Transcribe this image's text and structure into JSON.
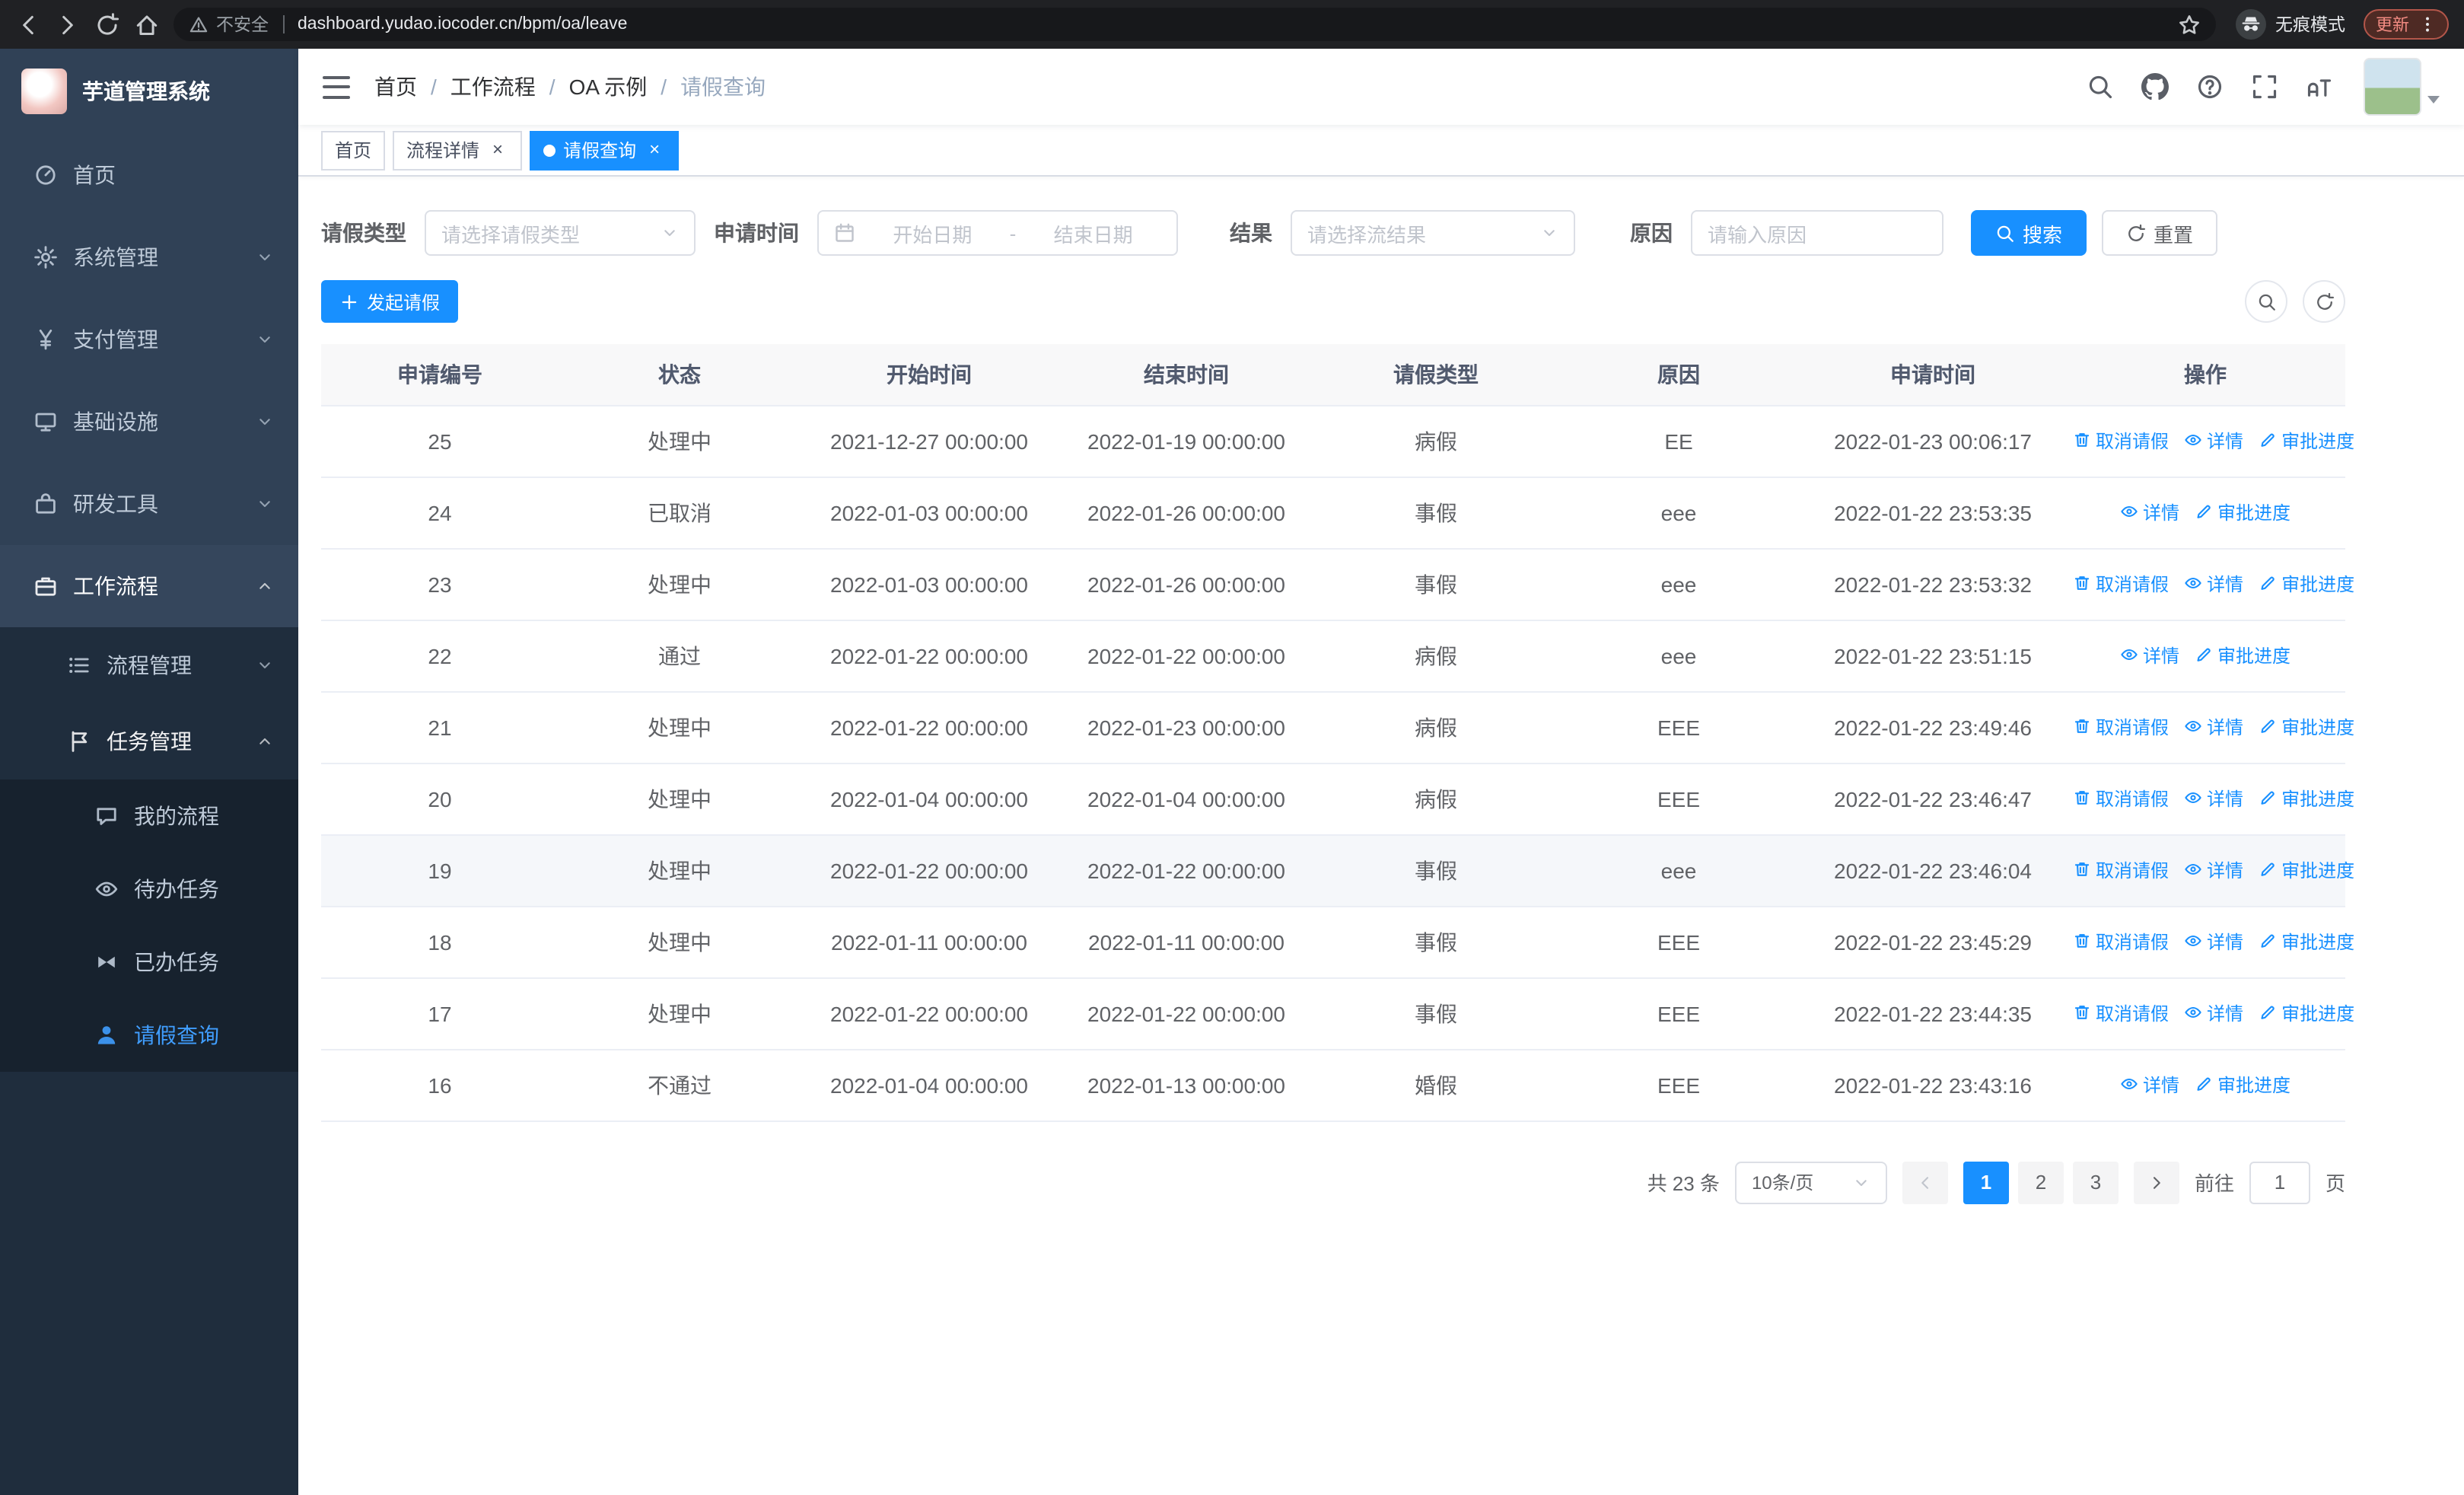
{
  "colors": {
    "primary": "#1890ff",
    "sidebar_bg": "#1f2d3d",
    "sidebar_top": "#304156",
    "sidebar_sub": "#1f2d3d",
    "sidebar_active_text": "#409eff",
    "table_header_bg": "#f8f8f9"
  },
  "browser": {
    "url": "dashboard.yudao.iocoder.cn/bpm/oa/leave",
    "security_warning": "不安全",
    "incognito_label": "无痕模式",
    "update_button": "更新"
  },
  "sidebar": {
    "logo_title": "芋道管理系统",
    "items": [
      {
        "key": "home",
        "label": "首页",
        "icon": "dashboard-icon",
        "level": 1
      },
      {
        "key": "system",
        "label": "系统管理",
        "icon": "gear-icon",
        "level": 1,
        "chevron": "down"
      },
      {
        "key": "payment",
        "label": "支付管理",
        "icon": "yen-icon",
        "level": 1,
        "chevron": "down"
      },
      {
        "key": "infra",
        "label": "基础设施",
        "icon": "infra-icon",
        "level": 1,
        "chevron": "down"
      },
      {
        "key": "devtools",
        "label": "研发工具",
        "icon": "tool-icon",
        "level": 1,
        "chevron": "down"
      },
      {
        "key": "workflow",
        "label": "工作流程",
        "icon": "briefcase-icon",
        "level": 1,
        "chevron": "up",
        "active_parent": true
      },
      {
        "key": "process-mgmt",
        "label": "流程管理",
        "icon": "list-icon",
        "level": 2,
        "chevron": "down"
      },
      {
        "key": "task-mgmt",
        "label": "任务管理",
        "icon": "flag-icon",
        "level": 2,
        "chevron": "up",
        "ancestor": true
      },
      {
        "key": "my-process",
        "label": "我的流程",
        "icon": "chat-icon",
        "level": 3
      },
      {
        "key": "todo-tasks",
        "label": "待办任务",
        "icon": "eye-icon",
        "level": 3
      },
      {
        "key": "done-tasks",
        "label": "已办任务",
        "icon": "bowtie-icon",
        "level": 3
      },
      {
        "key": "leave-query",
        "label": "请假查询",
        "icon": "user-icon",
        "level": 3,
        "active": true
      }
    ]
  },
  "header": {
    "breadcrumb": [
      "首页",
      "工作流程",
      "OA 示例",
      "请假查询"
    ]
  },
  "tabs": [
    {
      "key": "home",
      "label": "首页",
      "closable": false,
      "active": false
    },
    {
      "key": "process-detail",
      "label": "流程详情",
      "closable": true,
      "active": false
    },
    {
      "key": "leave-query",
      "label": "请假查询",
      "closable": true,
      "active": true
    }
  ],
  "filters": {
    "leave_type_label": "请假类型",
    "leave_type_placeholder": "请选择请假类型",
    "apply_time_label": "申请时间",
    "start_date_placeholder": "开始日期",
    "range_separator": "-",
    "end_date_placeholder": "结束日期",
    "result_label": "结果",
    "result_placeholder": "请选择流结果",
    "reason_label": "原因",
    "reason_placeholder": "请输入原因",
    "search_button": "搜索",
    "reset_button": "重置"
  },
  "toolbar": {
    "create_button": "发起请假"
  },
  "table": {
    "columns": [
      "申请编号",
      "状态",
      "开始时间",
      "结束时间",
      "请假类型",
      "原因",
      "申请时间",
      "操作"
    ],
    "action_labels": {
      "cancel": "取消请假",
      "detail": "详情",
      "progress": "审批进度"
    },
    "rows": [
      {
        "id": "25",
        "status": "处理中",
        "start": "2021-12-27 00:00:00",
        "end": "2022-01-19 00:00:00",
        "type": "病假",
        "reason": "EE",
        "applied": "2022-01-23 00:06:17",
        "actions": [
          "cancel",
          "detail",
          "progress"
        ]
      },
      {
        "id": "24",
        "status": "已取消",
        "start": "2022-01-03 00:00:00",
        "end": "2022-01-26 00:00:00",
        "type": "事假",
        "reason": "eee",
        "applied": "2022-01-22 23:53:35",
        "actions": [
          "detail",
          "progress"
        ]
      },
      {
        "id": "23",
        "status": "处理中",
        "start": "2022-01-03 00:00:00",
        "end": "2022-01-26 00:00:00",
        "type": "事假",
        "reason": "eee",
        "applied": "2022-01-22 23:53:32",
        "actions": [
          "cancel",
          "detail",
          "progress"
        ]
      },
      {
        "id": "22",
        "status": "通过",
        "start": "2022-01-22 00:00:00",
        "end": "2022-01-22 00:00:00",
        "type": "病假",
        "reason": "eee",
        "applied": "2022-01-22 23:51:15",
        "actions": [
          "detail",
          "progress"
        ]
      },
      {
        "id": "21",
        "status": "处理中",
        "start": "2022-01-22 00:00:00",
        "end": "2022-01-23 00:00:00",
        "type": "病假",
        "reason": "EEE",
        "applied": "2022-01-22 23:49:46",
        "actions": [
          "cancel",
          "detail",
          "progress"
        ]
      },
      {
        "id": "20",
        "status": "处理中",
        "start": "2022-01-04 00:00:00",
        "end": "2022-01-04 00:00:00",
        "type": "病假",
        "reason": "EEE",
        "applied": "2022-01-22 23:46:47",
        "actions": [
          "cancel",
          "detail",
          "progress"
        ]
      },
      {
        "id": "19",
        "status": "处理中",
        "start": "2022-01-22 00:00:00",
        "end": "2022-01-22 00:00:00",
        "type": "事假",
        "reason": "eee",
        "applied": "2022-01-22 23:46:04",
        "actions": [
          "cancel",
          "detail",
          "progress"
        ],
        "hovered": true
      },
      {
        "id": "18",
        "status": "处理中",
        "start": "2022-01-11 00:00:00",
        "end": "2022-01-11 00:00:00",
        "type": "事假",
        "reason": "EEE",
        "applied": "2022-01-22 23:45:29",
        "actions": [
          "cancel",
          "detail",
          "progress"
        ]
      },
      {
        "id": "17",
        "status": "处理中",
        "start": "2022-01-22 00:00:00",
        "end": "2022-01-22 00:00:00",
        "type": "事假",
        "reason": "EEE",
        "applied": "2022-01-22 23:44:35",
        "actions": [
          "cancel",
          "detail",
          "progress"
        ]
      },
      {
        "id": "16",
        "status": "不通过",
        "start": "2022-01-04 00:00:00",
        "end": "2022-01-13 00:00:00",
        "type": "婚假",
        "reason": "EEE",
        "applied": "2022-01-22 23:43:16",
        "actions": [
          "detail",
          "progress"
        ]
      }
    ]
  },
  "pagination": {
    "total_text": "共 23 条",
    "page_size": "10条/页",
    "pages": [
      "1",
      "2",
      "3"
    ],
    "active_page": "1",
    "goto_label": "前往",
    "goto_value": "1",
    "page_label": "页"
  }
}
